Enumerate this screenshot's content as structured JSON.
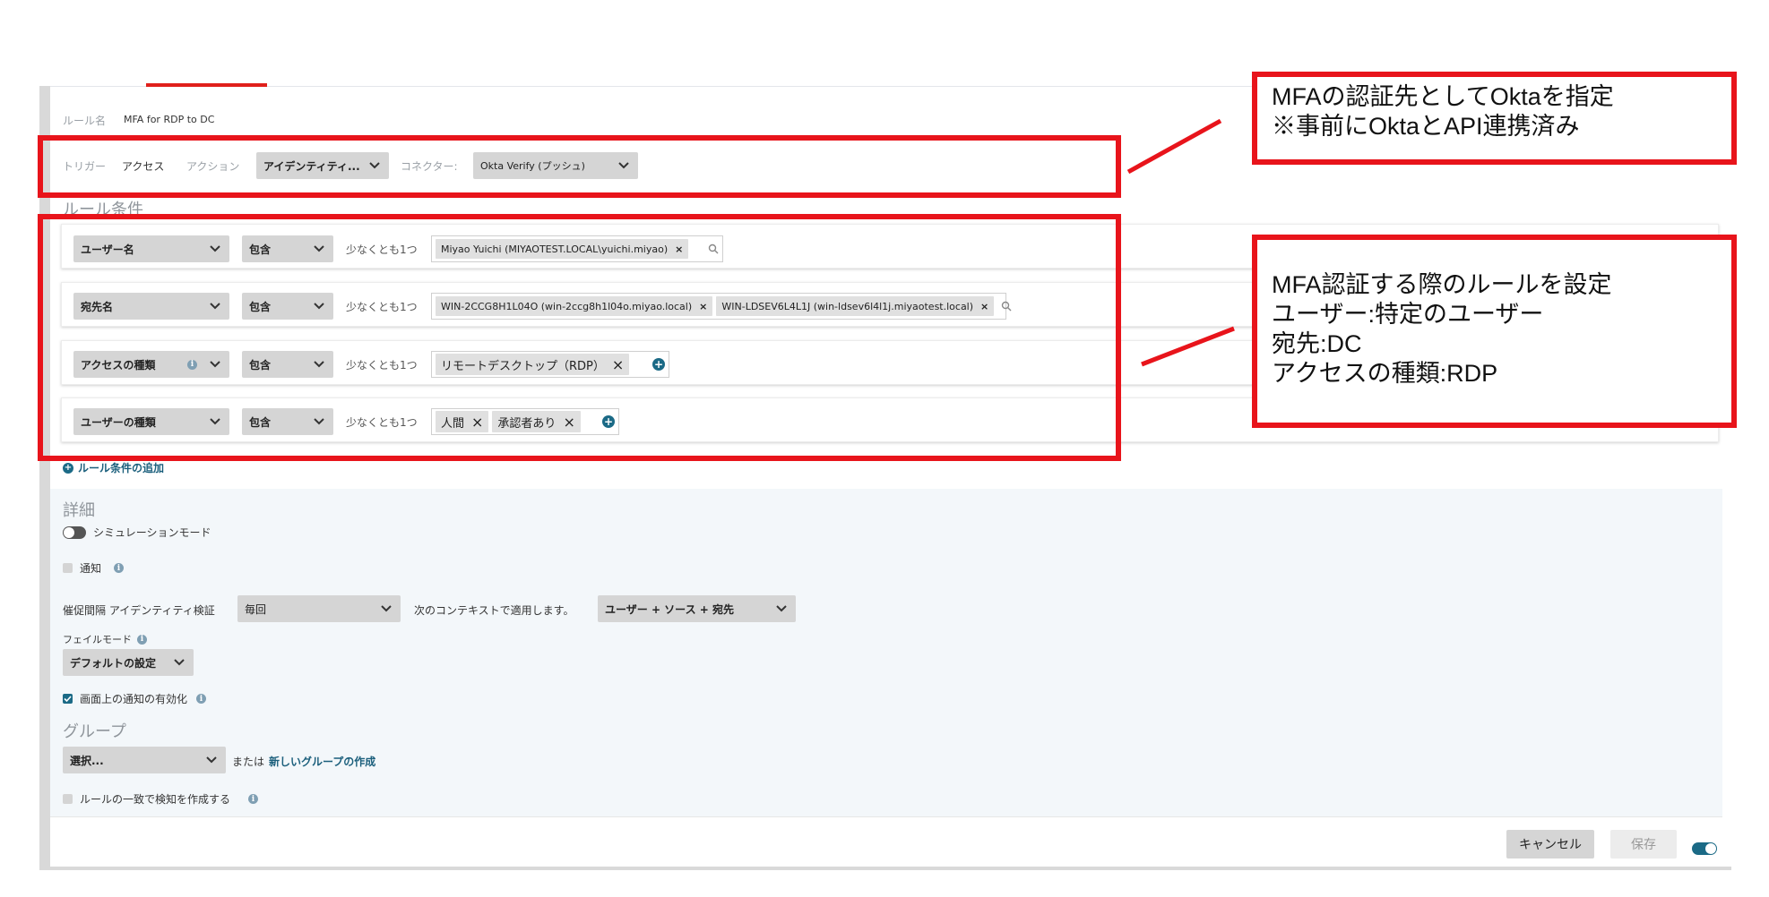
{
  "rule_name": {
    "label": "ルール名",
    "value": "MFA for RDP to DC"
  },
  "trigger": {
    "trigger_label": "トリガー",
    "trigger_value": "アクセス",
    "action_label": "アクション",
    "action_value": "アイデンティティ...",
    "connector_label": "コネクター:",
    "connector_value": "Okta Verify (プッシュ)"
  },
  "conditions": {
    "title": "ルール条件",
    "rows": [
      {
        "field": "ユーザー名",
        "operator": "包含",
        "qualifier": "少なくとも1つ",
        "tags": [
          "Miyao Yuichi (MIYAOTEST.LOCAL\\yuichi.miyao)"
        ]
      },
      {
        "field": "宛先名",
        "operator": "包含",
        "qualifier": "少なくとも1つ",
        "tags": [
          "WIN-2CCG8H1L04O (win-2ccg8h1l04o.miyao.local)",
          "WIN-LDSEV6L4L1J (win-ldsev6l4l1j.miyaotest.local)"
        ]
      },
      {
        "field": "アクセスの種類",
        "operator": "包含",
        "qualifier": "少なくとも1つ",
        "tags": [
          "リモートデスクトップ（RDP）"
        ]
      },
      {
        "field": "ユーザーの種類",
        "operator": "包含",
        "qualifier": "少なくとも1つ",
        "tags": [
          "人間",
          "承認者あり"
        ]
      }
    ],
    "add_label": "ルール条件の追加"
  },
  "details": {
    "title": "詳細",
    "simulation_label": "シミュレーションモード",
    "notify_label": "通知",
    "prompt_label": "催促間隔 アイデンティティ検証",
    "prompt_value": "毎回",
    "context_label": "次のコンテキストで適用します。",
    "context_value": "ユーザー + ソース + 宛先",
    "failmode_label": "フェイルモード",
    "failmode_value": "デフォルトの設定",
    "onscreen_label": "画面上の通知の有効化"
  },
  "group": {
    "title": "グループ",
    "select_value": "選択...",
    "or_label": "または",
    "new_group_link": "新しいグループの作成",
    "detect_label": "ルールの一致で検知を作成する"
  },
  "footer": {
    "cancel": "キャンセル",
    "save": "保存"
  },
  "annotations": {
    "top": [
      "MFAの認証先としてOktaを指定",
      "※事前にOktaとAPI連携済み"
    ],
    "rules": [
      "MFA認証する際のルールを設定",
      "ユーザー:特定のユーザー",
      "宛先:DC",
      "アクセスの種類:RDP"
    ]
  },
  "colors": {
    "highlight_red": "#e8141b",
    "accent_teal": "#1b6a86"
  }
}
